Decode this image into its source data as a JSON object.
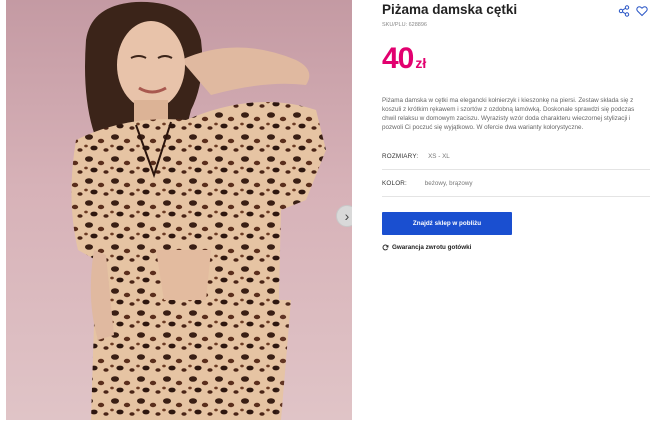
{
  "product": {
    "title": "Piżama damska cętki",
    "sku": "SKU/PLU: 628896",
    "price_value": "40",
    "price_currency": "zł",
    "description": "Piżama damska w cętki ma elegancki kołnierzyk i kieszonkę na piersi. Zestaw składa się z koszuli z krótkim rękawem i szortów z ozdobną lamówką. Doskonale sprawdzi się podczas chwil relaksu w domowym zaciszu. Wyrazisty wzór doda charakteru wieczornej stylizacji i pozwoli Ci poczuć się wyjątkowo. W ofercie dwa warianty kolorystyczne.",
    "sizes_label": "ROZMIARY:",
    "sizes_value": "XS - XL",
    "color_label": "KOLOR:",
    "color_value": "beżowy, brązowy"
  },
  "actions": {
    "find_store": "Znajdź sklep w pobliżu",
    "guarantee": "Gwarancja zwrotu gotówki"
  },
  "icons": {
    "share": "share-icon",
    "favorite": "heart-icon",
    "next": "chevron-right-icon",
    "refund": "refresh-icon"
  },
  "colors": {
    "price": "#e2006f",
    "accent": "#1a4fd0",
    "icon": "#2a56c6",
    "photo_background": "#d7b2b8"
  }
}
